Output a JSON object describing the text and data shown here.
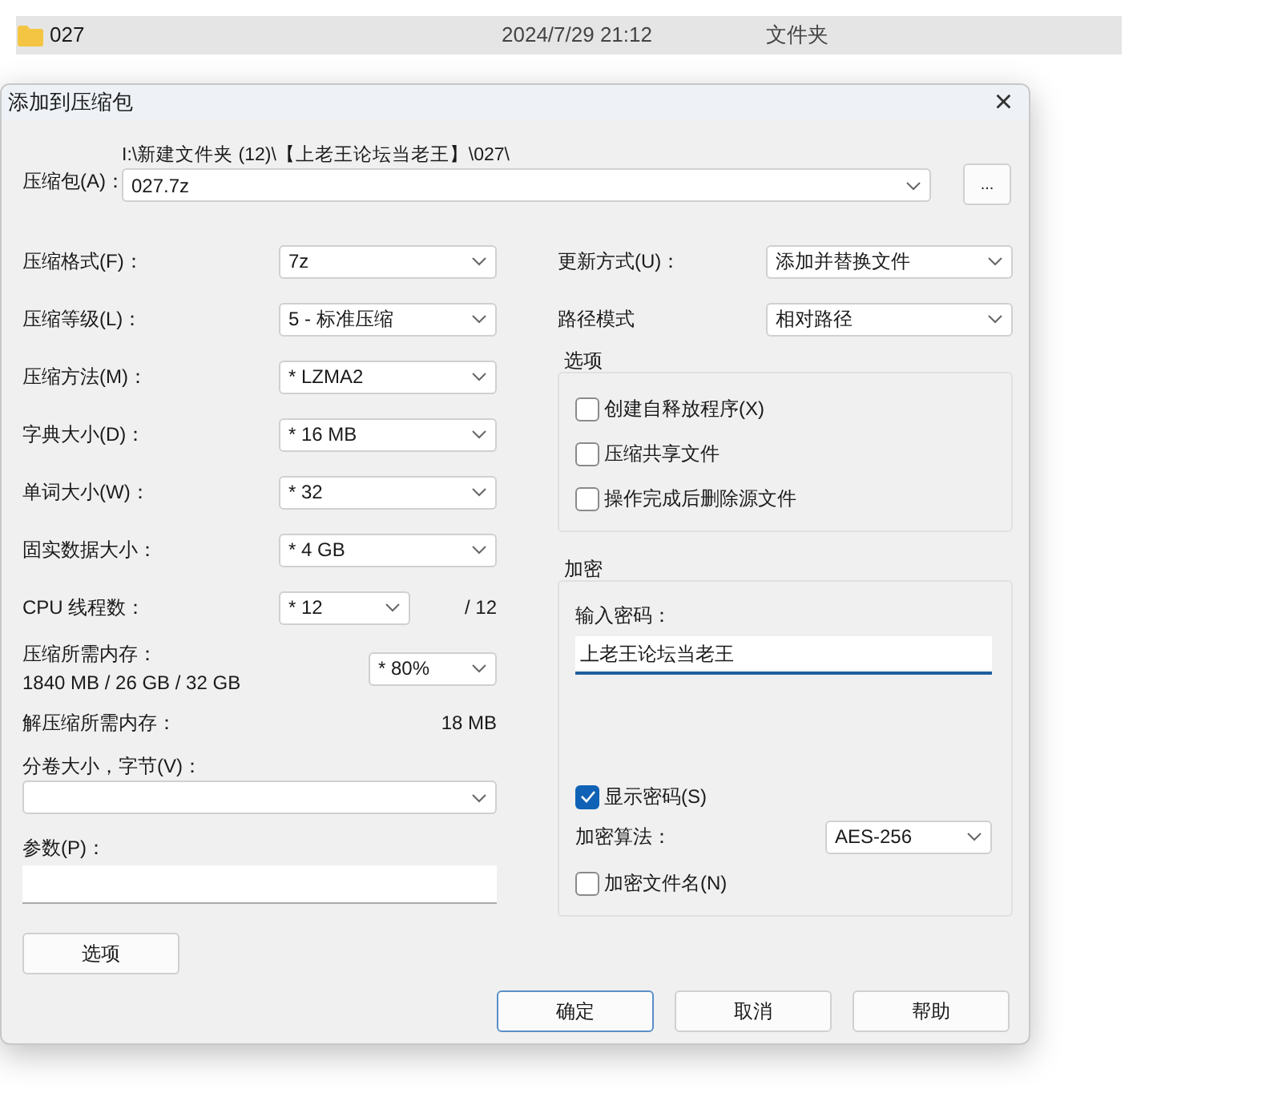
{
  "explorer_row": {
    "name": "027",
    "modified": "2024/7/29 21:12",
    "type": "文件夹",
    "selected": true
  },
  "dialog": {
    "title": "添加到压缩包",
    "close": "×",
    "archive": {
      "label": "压缩包(A)：",
      "path": "I:\\新建文件夹 (12)\\【上老王论坛当老王】\\027\\",
      "value": "027.7z",
      "browse": "..."
    },
    "settings": [
      {
        "label": "压缩格式(F)：",
        "value": "7z"
      },
      {
        "label": "压缩等级(L)：",
        "value": "5 - 标准压缩"
      },
      {
        "label": "压缩方法(M)：",
        "value": "* LZMA2"
      },
      {
        "label": "字典大小(D)：",
        "value": "* 16 MB"
      },
      {
        "label": "单词大小(W)：",
        "value": "* 32"
      },
      {
        "label": "固实数据大小：",
        "value": "* 4 GB"
      }
    ],
    "threads": {
      "label": "CPU 线程数：",
      "value": "* 12",
      "total": "/ 12"
    },
    "memory": {
      "label": "压缩所需内存：",
      "detail": "1840 MB / 26 GB / 32 GB",
      "value": "* 80%"
    },
    "decompress_memory": {
      "label": "解压缩所需内存：",
      "value": "18 MB"
    },
    "volume": {
      "label": "分卷大小，字节(V)："
    },
    "parameters": {
      "label": "参数(P)："
    },
    "options_button": "选项",
    "update_mode": {
      "label": "更新方式(U)：",
      "value": "添加并替换文件"
    },
    "path_mode": {
      "label": "路径模式",
      "value": "相对路径"
    },
    "options_group": {
      "title": "选项",
      "items": [
        {
          "label": "创建自释放程序(X)",
          "checked": false
        },
        {
          "label": "压缩共享文件",
          "checked": false
        },
        {
          "label": "操作完成后删除源文件",
          "checked": false
        }
      ]
    },
    "encryption": {
      "title": "加密",
      "password_label": "输入密码：",
      "password": "上老王论坛当老王",
      "show_password": {
        "label": "显示密码(S)",
        "checked": true
      },
      "method_label": "加密算法：",
      "method": "AES-256",
      "encrypt_names": {
        "label": "加密文件名(N)",
        "checked": false
      }
    },
    "buttons": [
      {
        "label": "确定",
        "default": true
      },
      {
        "label": "取消",
        "default": false
      },
      {
        "label": "帮助",
        "default": false
      }
    ]
  }
}
